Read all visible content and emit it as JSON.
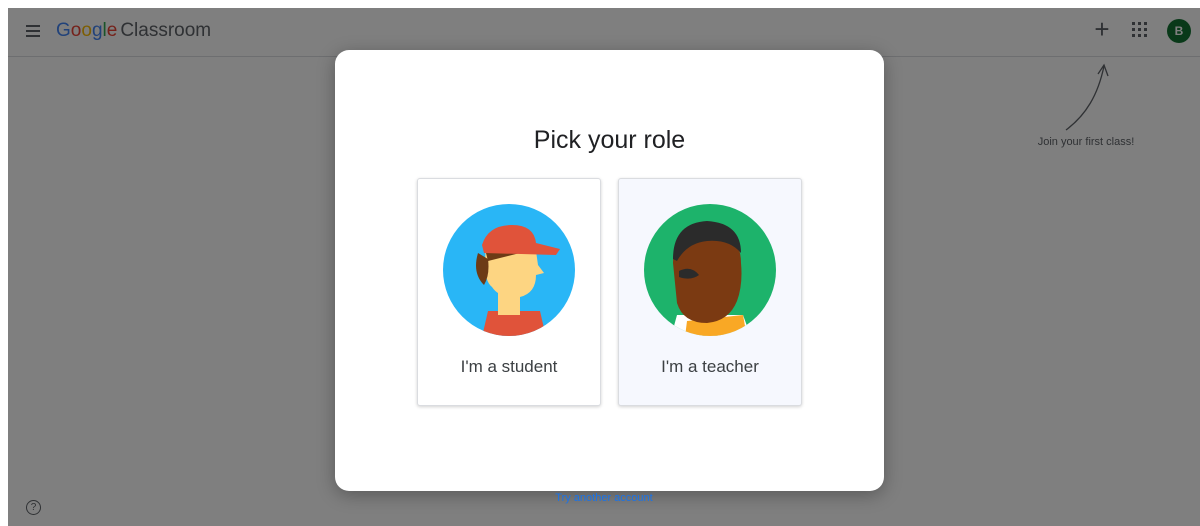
{
  "header": {
    "logo_google": [
      "G",
      "o",
      "o",
      "g",
      "l",
      "e"
    ],
    "logo_product": "Classroom",
    "avatar_initial": "B",
    "icons": [
      "menu-icon",
      "add-icon",
      "apps-icon"
    ]
  },
  "hint": {
    "text": "Join your first class!"
  },
  "dialog": {
    "title": "Pick your role",
    "roles": [
      {
        "label": "I'm a student",
        "illustration": "student-avatar"
      },
      {
        "label": "I'm a teacher",
        "illustration": "teacher-avatar"
      }
    ]
  },
  "footer": {
    "try_another": "Try another account",
    "help_icon": "?"
  },
  "colors": {
    "scrim": "#808080",
    "avatar_bg": "#137333",
    "link": "#1a73e8",
    "student_circle": "#29b6f6",
    "teacher_circle": "#1db36b"
  }
}
